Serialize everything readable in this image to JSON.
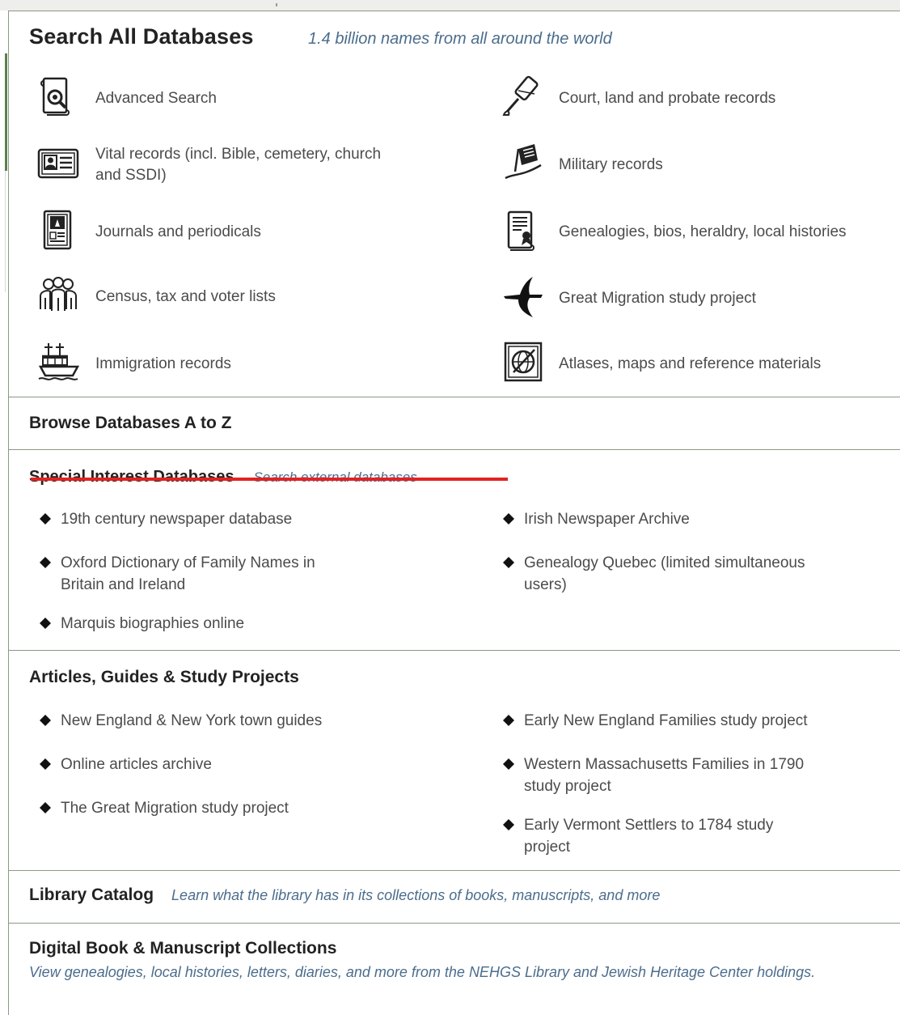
{
  "search_all": {
    "title": "Search All Databases",
    "subtitle": "1.4 billion names from all around the world",
    "left_items": [
      {
        "label": "Advanced Search",
        "icon": "advanced-search-icon"
      },
      {
        "label": "Vital records (incl. Bible, cemetery, church",
        "label2": "and SSDI)",
        "icon": "vital-records-icon"
      },
      {
        "label": "Journals and periodicals",
        "icon": "journals-icon"
      },
      {
        "label": "Census, tax and voter lists",
        "icon": "census-icon"
      },
      {
        "label": "Immigration records",
        "icon": "immigration-icon"
      }
    ],
    "right_items": [
      {
        "label": "Court, land and probate records",
        "icon": "gavel-icon"
      },
      {
        "label": "Military records",
        "icon": "military-icon"
      },
      {
        "label": "Genealogies, bios, heraldry, local histories",
        "icon": "genealogies-icon"
      },
      {
        "label": "Great Migration study project",
        "icon": "bird-icon"
      },
      {
        "label": "Atlases, maps and reference materials",
        "icon": "globe-icon"
      }
    ]
  },
  "browse": {
    "title": "Browse Databases A to Z"
  },
  "special": {
    "title": "Special Interest Databases",
    "subtitle": "Search external databases",
    "left_items": [
      {
        "label": "19th century newspaper database"
      },
      {
        "label": "Oxford Dictionary of Family Names in",
        "label2": "Britain and Ireland"
      },
      {
        "label": "Marquis biographies online"
      }
    ],
    "right_items": [
      {
        "label": "Irish Newspaper Archive"
      },
      {
        "label": "Genealogy Quebec (limited simultaneous",
        "label2": "users)"
      }
    ]
  },
  "articles": {
    "title": "Articles, Guides & Study Projects",
    "left_items": [
      {
        "label": "New England & New York town guides"
      },
      {
        "label": "Online articles archive"
      },
      {
        "label": "The Great Migration study project"
      }
    ],
    "right_items": [
      {
        "label": "Early New England Families study project"
      },
      {
        "label": "Western Massachusetts Families in 1790",
        "label2": "study project"
      },
      {
        "label": "Early Vermont Settlers to 1784 study",
        "label2": "project"
      }
    ]
  },
  "library_catalog": {
    "title": "Library Catalog",
    "subtitle": "Learn what the library has in its collections of books, manuscripts, and more"
  },
  "digital": {
    "title": "Digital Book & Manuscript Collections",
    "subtitle": "View genealogies, local histories, letters, diaries, and more from the NEHGS Library and Jewish Heritage Center holdings."
  },
  "colors": {
    "heading": "#222222",
    "body_text": "#4b4b4b",
    "italic_subtitle": "#4b6d8c",
    "strike": "#e32222",
    "divider": "#8a9a84"
  }
}
